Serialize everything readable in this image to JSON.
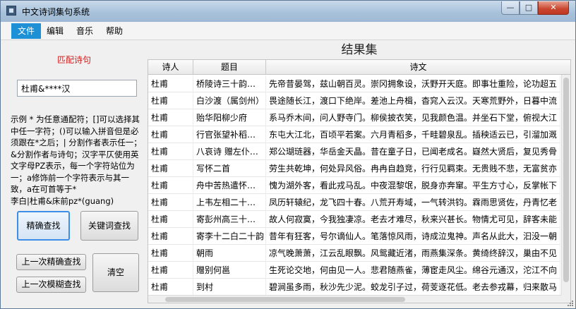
{
  "window": {
    "title": "中文诗词集句系统",
    "controls": {
      "minimize": "—",
      "maximize": "□",
      "close": "✕"
    }
  },
  "menu": [
    "文件",
    "编辑",
    "音乐",
    "帮助"
  ],
  "left": {
    "heading": "匹配诗句",
    "search_value": "杜甫&****汉",
    "hint": "示例 * 为任意通配符；[]可以选择其中任一字符；()可以输入拼音但是必须跟在*之后；| 分割作者表示任一； &分割作者与诗句；汉字平仄使用英文字母PZ表示，每一个字符站位为一；a修饰前一个字符表示与其一致，a在可首等于*",
    "example": "李白|杜甫&床前pz*(guang)",
    "buttons": {
      "exact": "精确查找",
      "keyword": "关键词查找",
      "prev_exact": "上一次精确查找",
      "prev_fuzzy": "上一次模糊查找",
      "clear": "清空"
    }
  },
  "results": {
    "title": "结果集",
    "columns": [
      "诗人",
      "题目",
      "诗文"
    ],
    "rows": [
      [
        "杜甫",
        "桥陵诗三十韵…",
        "先帝昔晏驾，兹山朝百灵。崇冈拥象设，沃野开天庭。即事壮重险，论功超五"
      ],
      [
        "杜甫",
        "白沙渡（属剑州）",
        "畏途随长江，渡口下绝岸。差池上舟楫，杳窕入云汉。天寒荒野外，日暮中流"
      ],
      [
        "杜甫",
        "贻华阳柳少府",
        "系马乔木间，问人野寺门。柳侯披衣笑，见我颜色温。并坐石下堂，俯视大江"
      ],
      [
        "杜甫",
        "行官张望补稻…",
        "东屯大江北，百顷平若案。六月青稻多，千畦碧泉乱。插秧适云已，引溜加溉"
      ],
      [
        "杜甫",
        "八哀诗 赠左仆…",
        "郑公瑚琏器，华岳金天晶。昔在童子日，已闻老成名。嶷然大贤后，复见秀骨"
      ],
      [
        "杜甫",
        "写怀二首",
        "劳生共乾坤，何处异风俗。冉冉自趋竞，行行见羁束。无贵贱不悲，无富贫亦"
      ],
      [
        "杜甫",
        "舟中苦热遣怀…",
        "愧为湖外客，看此戎马乱。中夜混黎氓，脱身亦奔窜。平生方寸心，反掌帐下"
      ],
      [
        "杜甫",
        "上韦左相二十…",
        "凤历轩辕纪，龙飞四十春。八荒开寿域，一气转洪钧。霖雨思贤佐，丹青忆老"
      ],
      [
        "杜甫",
        "寄彭州高三十…",
        "故人何寂寞，今我独凄凉。老去才难尽，秋来兴甚长。物情尤可见，辞客未能"
      ],
      [
        "杜甫",
        "寄李十二白二十韵",
        "昔年有狂客，号尔谪仙人。笔落惊风雨，诗成泣鬼神。声名从此大，汩没一朝"
      ],
      [
        "杜甫",
        "朝雨",
        "凉气晚萧萧，江云乱眼飘。风鸳藏近渚，雨燕集深条。黄绮终辞汉，巢由不见"
      ],
      [
        "杜甫",
        "赠别何邕",
        "生死论交地，何由见一人。悲君随燕雀，薄宦走风尘。绵谷元通汉，沱江不向"
      ],
      [
        "杜甫",
        "到村",
        "碧涧虽多雨，秋沙先少泥。蛟龙引子过，荷芰逐花低。老去参戎幕，归来散马"
      ]
    ]
  }
}
